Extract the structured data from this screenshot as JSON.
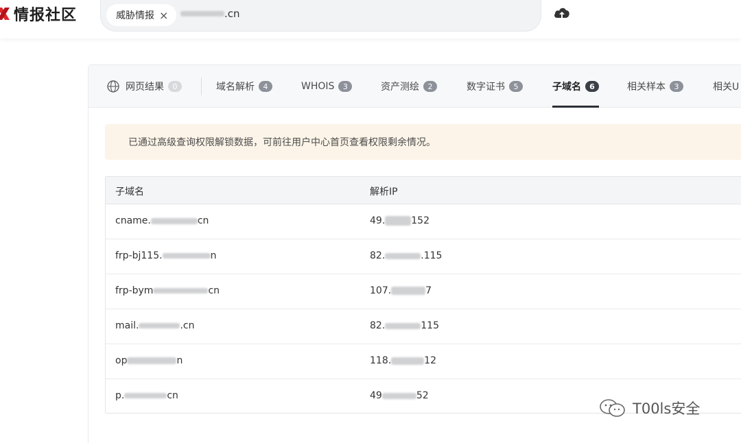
{
  "header": {
    "logo_text": "情报社区",
    "search": {
      "tag_label": "威胁情报",
      "query_suffix": ".cn"
    }
  },
  "tabs": [
    {
      "label": "网页结果",
      "count": "0"
    },
    {
      "label": "域名解析",
      "count": "4"
    },
    {
      "label": "WHOIS",
      "count": "3"
    },
    {
      "label": "资产测绘",
      "count": "2"
    },
    {
      "label": "数字证书",
      "count": "5"
    },
    {
      "label": "子域名",
      "count": "6"
    },
    {
      "label": "相关样本",
      "count": "3"
    },
    {
      "label": "相关U"
    }
  ],
  "notice": "已通过高级查询权限解锁数据，可前往用户中心首页查看权限剩余情况。",
  "table": {
    "headers": [
      "子域名",
      "解析IP"
    ],
    "rows": [
      {
        "domain_prefix": "cname.",
        "domain_suffix": "cn",
        "ip_prefix": "49.",
        "ip_suffix": "152"
      },
      {
        "domain_prefix": "frp-bj115.",
        "domain_suffix": "n",
        "ip_prefix": "82.",
        "ip_suffix": ".115"
      },
      {
        "domain_prefix": "frp-bym",
        "domain_suffix": "cn",
        "ip_prefix": "107.",
        "ip_suffix": "7"
      },
      {
        "domain_prefix": "mail.",
        "domain_suffix": ".cn",
        "ip_prefix": "82.",
        "ip_suffix": "115"
      },
      {
        "domain_prefix": "op",
        "domain_suffix": "n",
        "ip_prefix": "118.",
        "ip_suffix": "12"
      },
      {
        "domain_prefix": "p.",
        "domain_suffix": "cn",
        "ip_prefix": "49",
        "ip_suffix": "52"
      }
    ]
  },
  "watermark": "T00ls安全",
  "colors": {
    "logo_red": "#e0262c",
    "notice_bg": "#fcf4e8",
    "active_tab": "#2b2f36"
  }
}
